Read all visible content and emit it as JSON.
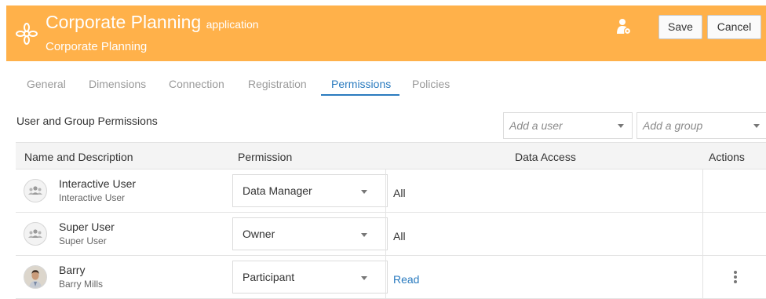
{
  "header": {
    "title": "Corporate Planning",
    "title_suffix": "application",
    "subtitle": "Corporate Planning",
    "save_label": "Save",
    "cancel_label": "Cancel",
    "accent_color": "#ffb14a"
  },
  "tabs": [
    {
      "label": "General",
      "active": false
    },
    {
      "label": "Dimensions",
      "active": false
    },
    {
      "label": "Connection",
      "active": false
    },
    {
      "label": "Registration",
      "active": false
    },
    {
      "label": "Permissions",
      "active": true
    },
    {
      "label": "Policies",
      "active": false
    }
  ],
  "section": {
    "title": "User and Group Permissions",
    "add_user_placeholder": "Add a user",
    "add_group_placeholder": "Add a group"
  },
  "table": {
    "columns": [
      "Name and Description",
      "Permission",
      "Data Access",
      "Actions"
    ],
    "rows": [
      {
        "name": "Interactive User",
        "description": "Interactive User",
        "avatar": "group-avatar-icon",
        "permission": "Data Manager",
        "data_access": "All",
        "data_access_link": false,
        "has_actions": false
      },
      {
        "name": "Super User",
        "description": "Super User",
        "avatar": "group-avatar-icon",
        "permission": "Owner",
        "data_access": "All",
        "data_access_link": false,
        "has_actions": false
      },
      {
        "name": "Barry",
        "description": "Barry Mills",
        "avatar": "user-photo",
        "permission": "Participant",
        "data_access": "Read",
        "data_access_link": true,
        "has_actions": true
      }
    ]
  }
}
